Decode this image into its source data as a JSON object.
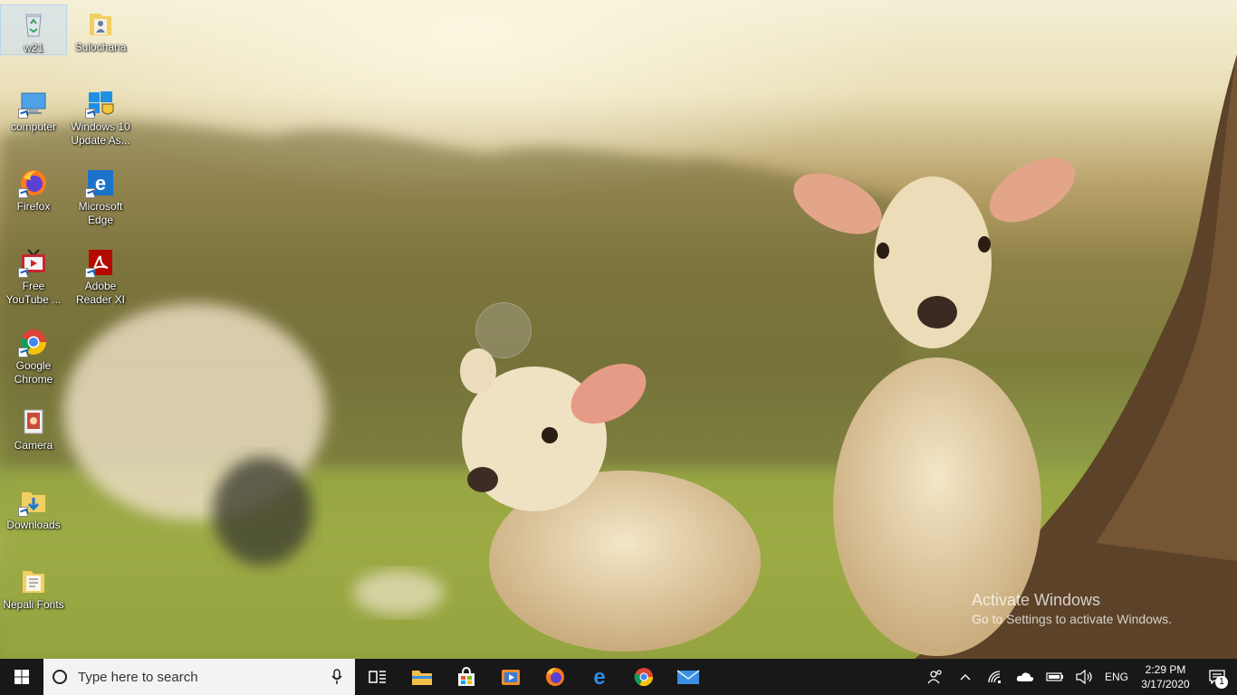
{
  "desktop": {
    "icons": [
      {
        "label": "w21",
        "icon": "recycle-bin-icon"
      },
      {
        "label": "Sulochana",
        "icon": "user-folder-icon"
      },
      {
        "label": "computer",
        "icon": "computer-icon"
      },
      {
        "label": "Windows 10 Update As...",
        "icon": "windows-update-icon"
      },
      {
        "label": "Firefox",
        "icon": "firefox-icon"
      },
      {
        "label": "Microsoft Edge",
        "icon": "edge-icon"
      },
      {
        "label": "Free YouTube ...",
        "icon": "youtube-downloader-icon"
      },
      {
        "label": "Adobe Reader XI",
        "icon": "adobe-reader-icon"
      },
      {
        "label": "Google Chrome",
        "icon": "chrome-icon"
      },
      {
        "label": "Camera",
        "icon": "camera-icon"
      },
      {
        "label": "Downloads",
        "icon": "downloads-folder-icon"
      },
      {
        "label": "Nepali Fonts",
        "icon": "fonts-folder-icon"
      }
    ],
    "selected_icon": "w21"
  },
  "watermark": {
    "title": "Activate Windows",
    "subtitle": "Go to Settings to activate Windows."
  },
  "taskbar": {
    "search_placeholder": "Type here to search",
    "pinned": [
      "task-view-icon",
      "file-explorer-icon",
      "store-icon",
      "media-player-icon",
      "firefox-icon",
      "edge-icon",
      "chrome-icon",
      "mail-icon"
    ],
    "tray": {
      "language": "ENG",
      "time": "2:29 PM",
      "date": "3/17/2020",
      "notification_count": "1"
    }
  },
  "colors": {
    "taskbar": "#181818",
    "search_box": "#f3f3f3",
    "accent": "#0078d7"
  }
}
